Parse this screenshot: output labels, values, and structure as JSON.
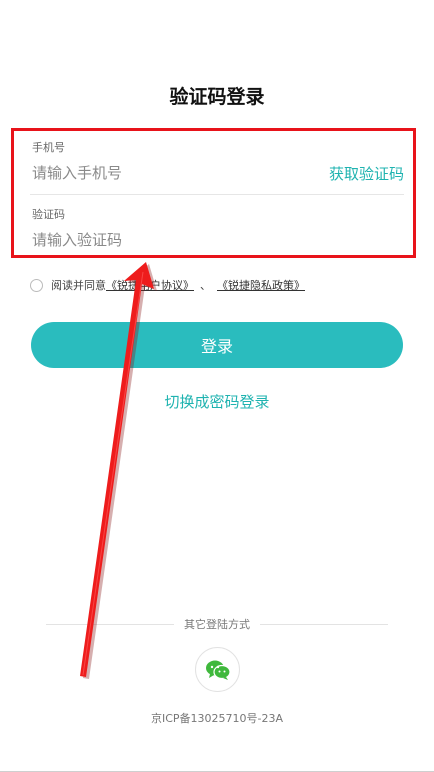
{
  "header": {
    "title": "验证码登录"
  },
  "form": {
    "phone": {
      "label": "手机号",
      "placeholder": "请输入手机号",
      "value": ""
    },
    "get_code_label": "获取验证码",
    "code": {
      "label": "验证码",
      "placeholder": "请输入验证码",
      "value": ""
    }
  },
  "agreement": {
    "prefix": "阅读并同意",
    "user_agreement": "《锐捷用户协议》",
    "separator": "、",
    "privacy_policy": "《锐捷隐私政策》",
    "checked": false
  },
  "actions": {
    "login_label": "登录",
    "switch_label": "切换成密码登录"
  },
  "other_login": {
    "label": "其它登陆方式",
    "methods": [
      {
        "icon": "wechat-icon"
      }
    ]
  },
  "footer": {
    "icp": "京ICP备13025710号-23A"
  },
  "colors": {
    "accent": "#2abcbe",
    "link": "#1fb3b0",
    "annotation": "#e8131a",
    "wechat": "#3fb83c"
  }
}
